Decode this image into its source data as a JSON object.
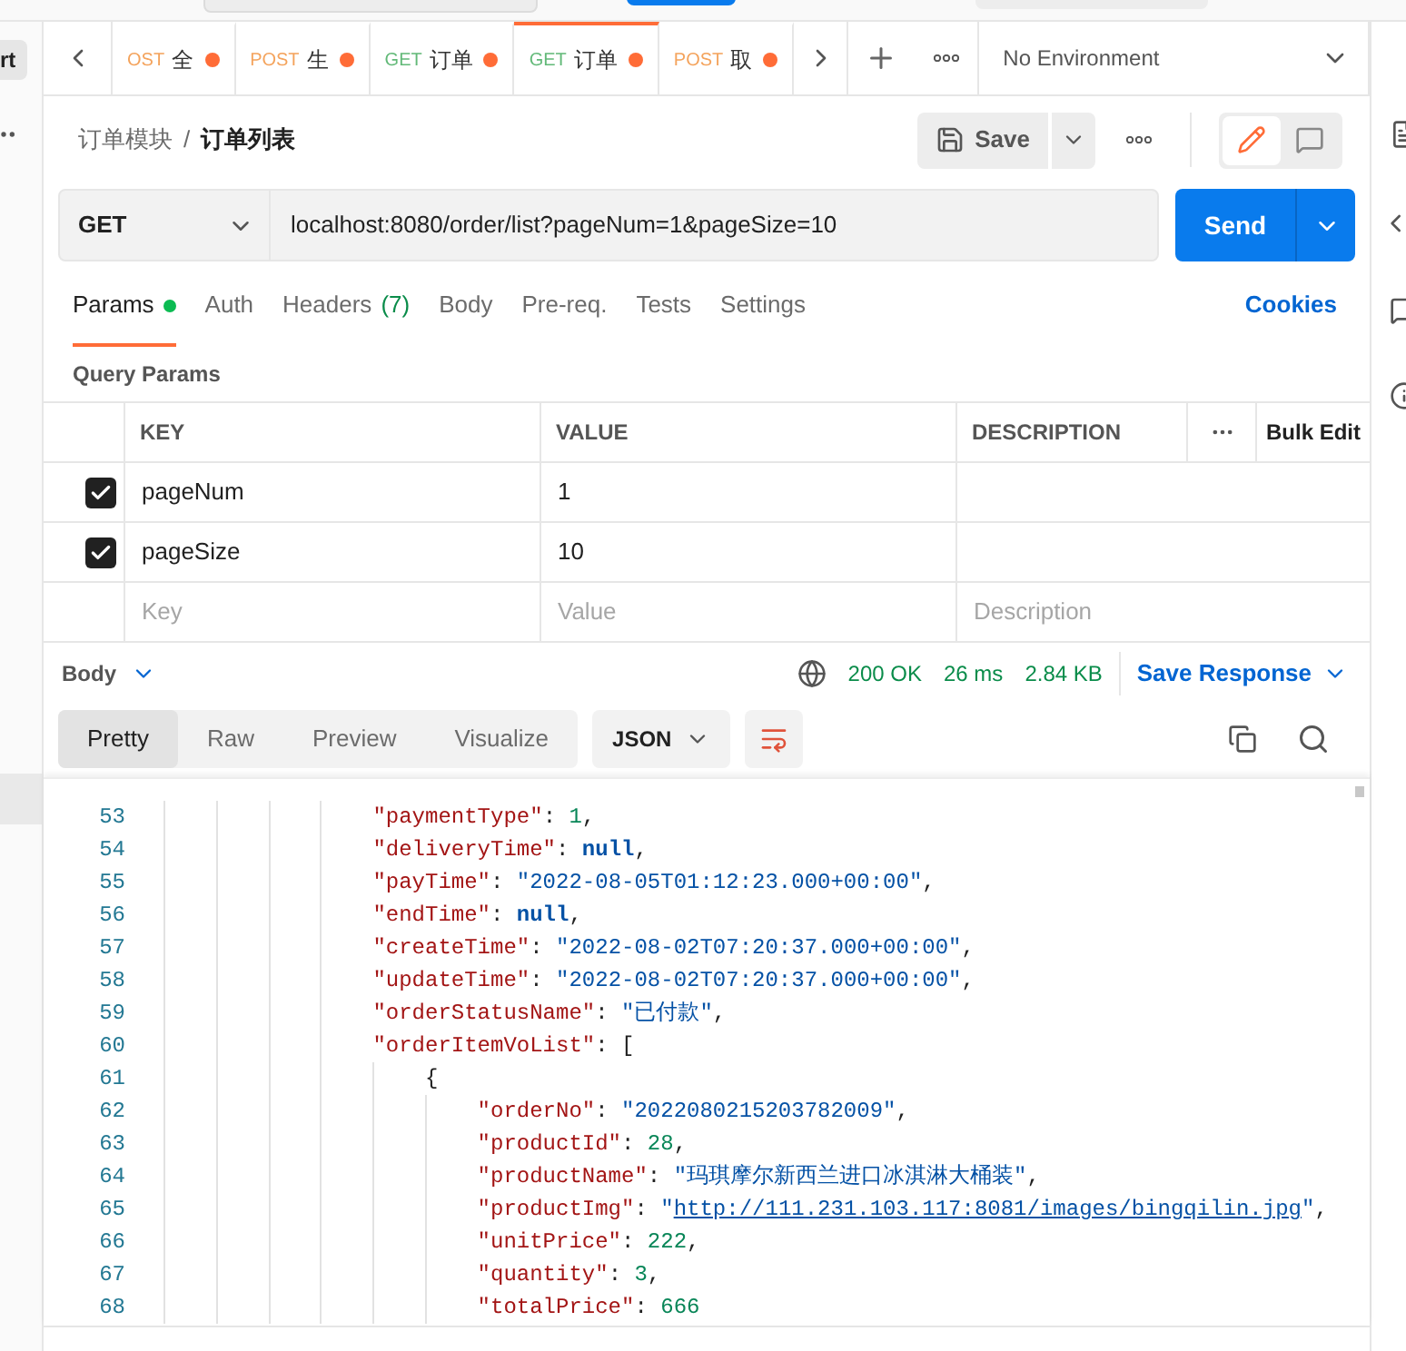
{
  "sidebar_button": "rt",
  "tabs": [
    {
      "method": "OST",
      "color": "#f4a35c",
      "title": "全",
      "unsaved": true,
      "selected": false
    },
    {
      "method": "POST",
      "color": "#f4a35c",
      "title": "生",
      "unsaved": true,
      "selected": false
    },
    {
      "method": "GET",
      "color": "#62b978",
      "title": "订单",
      "unsaved": true,
      "selected": false
    },
    {
      "method": "GET",
      "color": "#62b978",
      "title": "订单",
      "unsaved": true,
      "selected": true
    },
    {
      "method": "POST",
      "color": "#f4a35c",
      "title": "取",
      "unsaved": true,
      "selected": false
    }
  ],
  "environment": "No Environment",
  "breadcrumb": [
    "订单模块",
    "订单列表"
  ],
  "breadcrumb_separator": "/",
  "save_button": "Save",
  "request": {
    "method": "GET",
    "url": "localhost:8080/order/list?pageNum=1&pageSize=10"
  },
  "send_button": "Send",
  "request_tabs": [
    {
      "label": "Params",
      "selected": true,
      "indicator": true
    },
    {
      "label": "Auth",
      "selected": false,
      "indicator": false
    },
    {
      "label": "Headers",
      "count": "(7)",
      "selected": false,
      "indicator": false
    },
    {
      "label": "Body",
      "selected": false,
      "indicator": false
    },
    {
      "label": "Pre-req.",
      "selected": false,
      "indicator": false
    },
    {
      "label": "Tests",
      "selected": false,
      "indicator": false
    },
    {
      "label": "Settings",
      "selected": false,
      "indicator": false
    }
  ],
  "cookies_link": "Cookies",
  "query_params": {
    "title": "Query Params",
    "columns": [
      "KEY",
      "VALUE",
      "DESCRIPTION"
    ],
    "bulk_edit": "Bulk Edit",
    "rows": [
      {
        "checked": true,
        "key": "pageNum",
        "value": "1"
      },
      {
        "checked": true,
        "key": "pageSize",
        "value": "10"
      }
    ],
    "new_row": {
      "key_field": {
        "placeholder": "Key"
      },
      "value_field": {
        "placeholder": "Value"
      },
      "description_field": {
        "placeholder": "Description"
      }
    }
  },
  "response": {
    "section": "Body",
    "status": "200 OK",
    "time": "26 ms",
    "size": "2.84 KB",
    "save_response": "Save Response",
    "view_tabs": [
      {
        "label": "Pretty",
        "selected": true
      },
      {
        "label": "Raw",
        "selected": false
      },
      {
        "label": "Preview",
        "selected": false
      },
      {
        "label": "Visualize",
        "selected": false
      }
    ],
    "format": "JSON",
    "lines": [
      {
        "number": "53",
        "tokens": [
          {
            "kind": "key",
            "text": "\"paymentType\""
          },
          {
            "kind": "punct",
            "text": ": "
          },
          {
            "kind": "number",
            "text": "1"
          },
          {
            "kind": "punct",
            "text": ","
          }
        ]
      },
      {
        "number": "54",
        "tokens": [
          {
            "kind": "key",
            "text": "\"deliveryTime\""
          },
          {
            "kind": "punct",
            "text": ": "
          },
          {
            "kind": "null",
            "text": "null"
          },
          {
            "kind": "punct",
            "text": ","
          }
        ]
      },
      {
        "number": "55",
        "tokens": [
          {
            "kind": "key",
            "text": "\"payTime\""
          },
          {
            "kind": "punct",
            "text": ": "
          },
          {
            "kind": "string",
            "text": "\"2022-08-05T01:12:23.000+00:00\""
          },
          {
            "kind": "punct",
            "text": ","
          }
        ]
      },
      {
        "number": "56",
        "tokens": [
          {
            "kind": "key",
            "text": "\"endTime\""
          },
          {
            "kind": "punct",
            "text": ": "
          },
          {
            "kind": "null",
            "text": "null"
          },
          {
            "kind": "punct",
            "text": ","
          }
        ]
      },
      {
        "number": "57",
        "tokens": [
          {
            "kind": "key",
            "text": "\"createTime\""
          },
          {
            "kind": "punct",
            "text": ": "
          },
          {
            "kind": "string",
            "text": "\"2022-08-02T07:20:37.000+00:00\""
          },
          {
            "kind": "punct",
            "text": ","
          }
        ]
      },
      {
        "number": "58",
        "tokens": [
          {
            "kind": "key",
            "text": "\"updateTime\""
          },
          {
            "kind": "punct",
            "text": ": "
          },
          {
            "kind": "string",
            "text": "\"2022-08-02T07:20:37.000+00:00\""
          },
          {
            "kind": "punct",
            "text": ","
          }
        ]
      },
      {
        "number": "59",
        "tokens": [
          {
            "kind": "key",
            "text": "\"orderStatusName\""
          },
          {
            "kind": "punct",
            "text": ": "
          },
          {
            "kind": "string",
            "text": "\"已付款\""
          },
          {
            "kind": "punct",
            "text": ","
          }
        ]
      },
      {
        "number": "60",
        "tokens": [
          {
            "kind": "key",
            "text": "\"orderItemVoList\""
          },
          {
            "kind": "punct",
            "text": ": ["
          }
        ],
        "children": [
          {
            "number": "61",
            "tokens": [
              {
                "kind": "punct",
                "text": "{"
              }
            ],
            "children": [
              {
                "number": "62",
                "tokens": [
                  {
                    "kind": "key",
                    "text": "\"orderNo\""
                  },
                  {
                    "kind": "punct",
                    "text": ": "
                  },
                  {
                    "kind": "string",
                    "text": "\"2022080215203782009\""
                  },
                  {
                    "kind": "punct",
                    "text": ","
                  }
                ]
              },
              {
                "number": "63",
                "tokens": [
                  {
                    "kind": "key",
                    "text": "\"productId\""
                  },
                  {
                    "kind": "punct",
                    "text": ": "
                  },
                  {
                    "kind": "number",
                    "text": "28"
                  },
                  {
                    "kind": "punct",
                    "text": ","
                  }
                ]
              },
              {
                "number": "64",
                "tokens": [
                  {
                    "kind": "key",
                    "text": "\"productName\""
                  },
                  {
                    "kind": "punct",
                    "text": ": "
                  },
                  {
                    "kind": "string",
                    "text": "\"玛琪摩尔新西兰进口冰淇淋大桶装\""
                  },
                  {
                    "kind": "punct",
                    "text": ","
                  }
                ]
              },
              {
                "number": "65",
                "tokens": [
                  {
                    "kind": "key",
                    "text": "\"productImg\""
                  },
                  {
                    "kind": "punct",
                    "text": ": "
                  },
                  {
                    "kind": "string",
                    "text": "\""
                  },
                  {
                    "kind": "link",
                    "text": "http://111.231.103.117:8081/images/bingqilin.jpg"
                  },
                  {
                    "kind": "string",
                    "text": "\""
                  },
                  {
                    "kind": "punct",
                    "text": ","
                  }
                ]
              },
              {
                "number": "66",
                "tokens": [
                  {
                    "kind": "key",
                    "text": "\"unitPrice\""
                  },
                  {
                    "kind": "punct",
                    "text": ": "
                  },
                  {
                    "kind": "number",
                    "text": "222"
                  },
                  {
                    "kind": "punct",
                    "text": ","
                  }
                ]
              },
              {
                "number": "67",
                "tokens": [
                  {
                    "kind": "key",
                    "text": "\"quantity\""
                  },
                  {
                    "kind": "punct",
                    "text": ": "
                  },
                  {
                    "kind": "number",
                    "text": "3"
                  },
                  {
                    "kind": "punct",
                    "text": ","
                  }
                ]
              },
              {
                "number": "68",
                "tokens": [
                  {
                    "kind": "key",
                    "text": "\"totalPrice\""
                  },
                  {
                    "kind": "punct",
                    "text": ": "
                  },
                  {
                    "kind": "number",
                    "text": "666"
                  }
                ]
              }
            ]
          }
        ]
      }
    ]
  }
}
